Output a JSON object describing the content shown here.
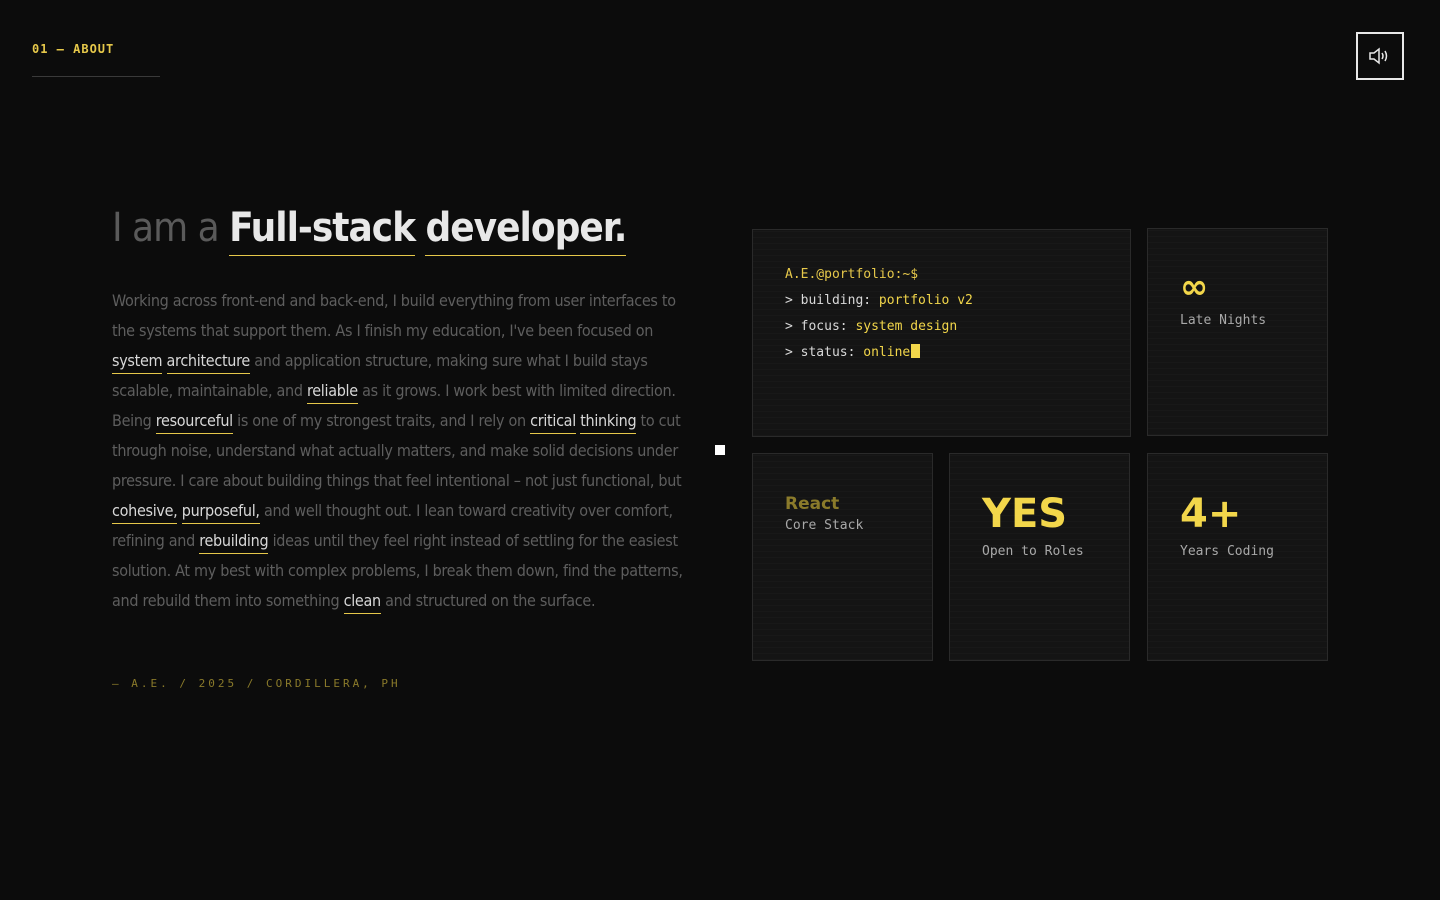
{
  "section": {
    "label": "01 — ABOUT"
  },
  "sound_button": {
    "icon": "speaker-icon"
  },
  "headline": {
    "prefix": "I am a",
    "highlights": [
      "Full-stack",
      "developer."
    ]
  },
  "bio": {
    "segments": [
      {
        "text": "Working across front-end and back-end, I build everything from user interfaces to the systems that support them. As I finish my education, I've been focused on ",
        "kw": false
      },
      {
        "text": "system",
        "kw": true
      },
      {
        "text": " ",
        "kw": false
      },
      {
        "text": "architecture",
        "kw": true
      },
      {
        "text": " and application structure, making sure what I build stays scalable, maintainable, and ",
        "kw": false
      },
      {
        "text": "reliable",
        "kw": true
      },
      {
        "text": " as it grows. I work best with limited direction. Being ",
        "kw": false
      },
      {
        "text": "resourceful",
        "kw": true
      },
      {
        "text": " is one of my strongest traits, and I rely on ",
        "kw": false
      },
      {
        "text": "critical",
        "kw": true
      },
      {
        "text": " ",
        "kw": false
      },
      {
        "text": "thinking",
        "kw": true
      },
      {
        "text": " to cut through noise, understand what actually matters, and make solid decisions under pressure. I care about building things that feel intentional – not just functional, but ",
        "kw": false
      },
      {
        "text": "cohesive,",
        "kw": true
      },
      {
        "text": " ",
        "kw": false
      },
      {
        "text": "purposeful,",
        "kw": true
      },
      {
        "text": " and well thought out. I lean toward creativity over comfort, refining and ",
        "kw": false
      },
      {
        "text": "rebuilding",
        "kw": true
      },
      {
        "text": " ideas until they feel right instead of settling for the easiest solution. At my best with complex problems, I break them down, find the patterns, and rebuild them into something ",
        "kw": false
      },
      {
        "text": "clean",
        "kw": true
      },
      {
        "text": " and structured on the surface.",
        "kw": false
      }
    ]
  },
  "signature": "— A.E. / 2025 / CORDILLERA, PH",
  "terminal": {
    "prompt": "A.E.@portfolio:~$",
    "lines": [
      {
        "key": "> building:",
        "value": "portfolio v2"
      },
      {
        "key": "> focus:",
        "value": "system design"
      },
      {
        "key": "> status:",
        "value": "online"
      }
    ]
  },
  "stats": {
    "nights": {
      "big": "∞",
      "sub": "Late Nights"
    },
    "react": {
      "big": "React",
      "sub": "Core Stack"
    },
    "roles": {
      "big": "YES",
      "sub": "Open to Roles"
    },
    "years": {
      "big": "4+",
      "sub": "Years Coding"
    }
  },
  "colors": {
    "accent": "#f2d64a",
    "background": "#0c0c0c",
    "card": "#141414"
  }
}
